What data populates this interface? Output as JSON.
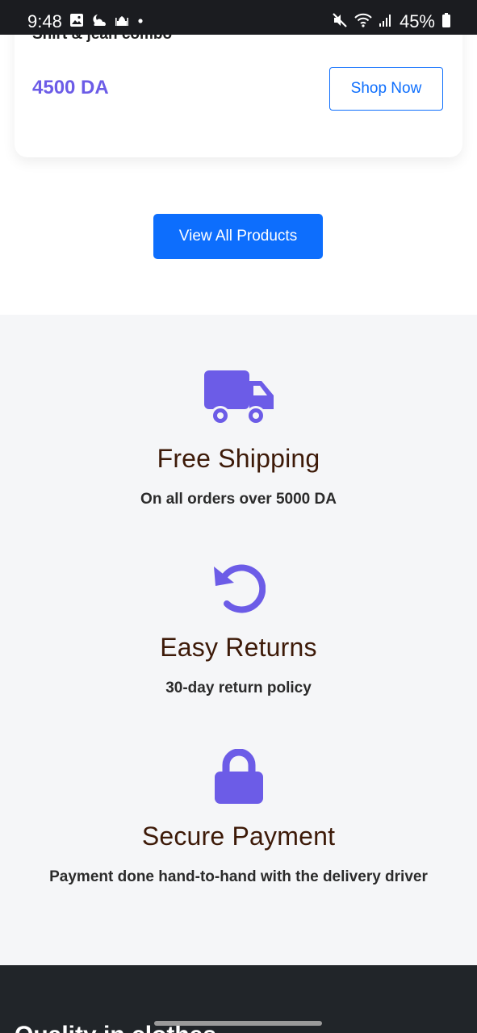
{
  "status_bar": {
    "time": "9:48",
    "battery": "45%",
    "left_icons": [
      "gallery-icon",
      "weather-icon",
      "mosque-icon",
      "dot-icon"
    ],
    "right_icons": [
      "mute-icon",
      "wifi-icon",
      "signal-icon",
      "battery-icon"
    ]
  },
  "product_card": {
    "title": "Shirt & jean combo",
    "price": "4500 DA",
    "shop_button": "Shop Now"
  },
  "view_all_button": "View All Products",
  "features": [
    {
      "icon": "truck-icon",
      "title": "Free Shipping",
      "description": "On all orders over 5000 DA"
    },
    {
      "icon": "rotate-left-icon",
      "title": "Easy Returns",
      "description": "30-day return policy"
    },
    {
      "icon": "lock-icon",
      "title": "Secure Payment",
      "description": "Payment done hand-to-hand with the delivery driver"
    }
  ],
  "footer": {
    "title": "Quality in clothes"
  },
  "colors": {
    "accent_purple": "#6c5ce7",
    "primary_blue": "#0d6efd",
    "heading_brown": "#3d1a08",
    "footer_dark": "#212529",
    "section_bg": "#f5f6f8"
  }
}
